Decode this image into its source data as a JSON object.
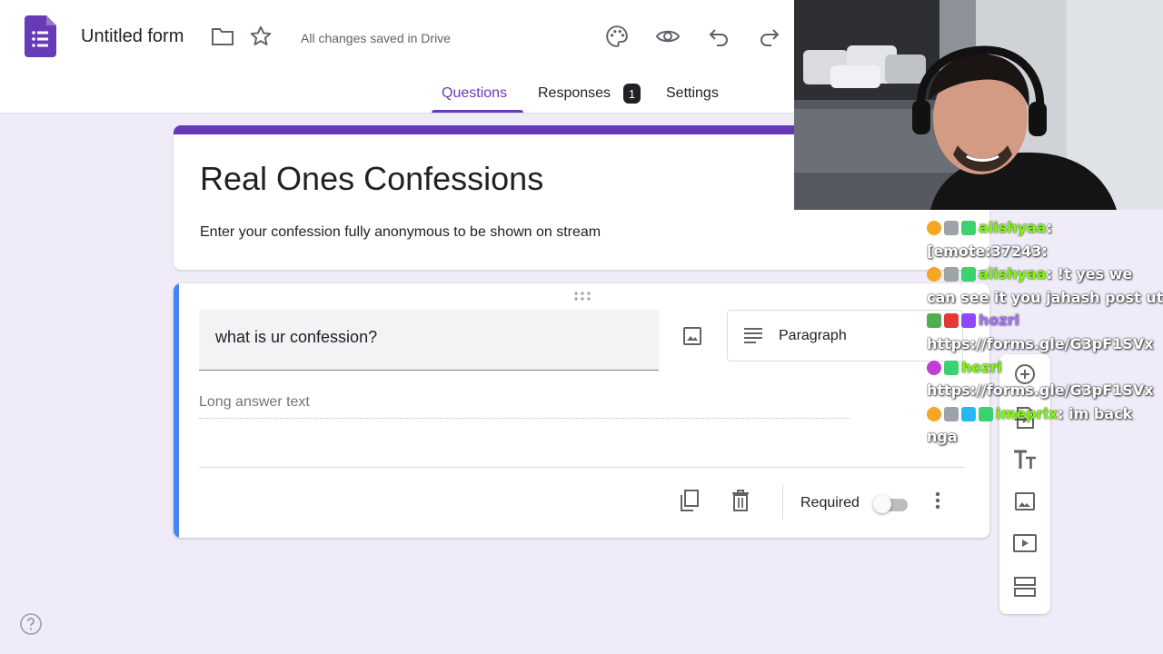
{
  "header": {
    "title": "Untitled form",
    "saved_status": "All changes saved in Drive",
    "tabs": [
      {
        "label": "Questions",
        "active": true
      },
      {
        "label": "Responses",
        "badge": "1"
      },
      {
        "label": "Settings"
      }
    ]
  },
  "form": {
    "title": "Real Ones Confessions",
    "description": "Enter your confession fully anonymous to be shown on stream"
  },
  "question": {
    "text": "what is ur confession?",
    "type": "Paragraph",
    "answer_placeholder": "Long answer text",
    "required_label": "Required",
    "required": false
  },
  "chat": [
    {
      "user": "alishyaa",
      "user_color": "#7cfc00",
      "text": ":",
      "text2": "[emote:37243:"
    },
    {
      "user": "alishyaa",
      "user_color": "#7cfc00",
      "text": ": !t yes we",
      "text2": "can see it you jahash post ut"
    },
    {
      "user": "hozri",
      "user_color": "#a970ff",
      "text": "",
      "text2": "https://forms.gle/G3pF1SVx"
    },
    {
      "user": "hozri",
      "user_color": "#7cfc00",
      "text": "",
      "text2": "https://forms.gle/G3pF1SVx"
    },
    {
      "user": "imeprix",
      "user_color": "#7cfc00",
      "text": ": im back",
      "text2": "nga"
    }
  ],
  "colors": {
    "accent": "#673ab7",
    "focus": "#4285f4",
    "background": "#f0ebf8"
  }
}
